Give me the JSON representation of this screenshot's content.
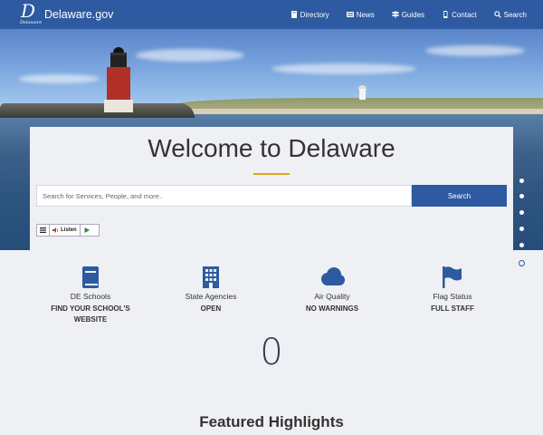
{
  "header": {
    "logo_letter": "D",
    "logo_subtext": "Delaware",
    "site_name": "Delaware.gov",
    "nav": [
      {
        "label": "Directory",
        "icon": "book-icon"
      },
      {
        "label": "News",
        "icon": "newspaper-icon"
      },
      {
        "label": "Guides",
        "icon": "signpost-icon"
      },
      {
        "label": "Contact",
        "icon": "phone-icon"
      },
      {
        "label": "Search",
        "icon": "search-icon"
      }
    ]
  },
  "hero": {
    "title": "Welcome to Delaware",
    "search_placeholder": "Search for Services, People, and more..",
    "search_button": "Search",
    "listen_label": "Listen",
    "slide_count": 6,
    "active_slide": 6
  },
  "quick_info": [
    {
      "icon": "book-icon",
      "label": "DE Schools",
      "value": "FIND YOUR SCHOOL'S WEBSITE"
    },
    {
      "icon": "building-icon",
      "label": "State Agencies",
      "value": "OPEN"
    },
    {
      "icon": "cloud-icon",
      "label": "Air Quality",
      "value": "NO WARNINGS"
    },
    {
      "icon": "flag-icon",
      "label": "Flag Status",
      "value": "FULL STAFF"
    }
  ],
  "counter": "0",
  "featured_title": "Featured Highlights",
  "colors": {
    "brand_blue": "#2d5aa0",
    "accent_gold": "#d9a520",
    "background": "#eef0f3"
  }
}
